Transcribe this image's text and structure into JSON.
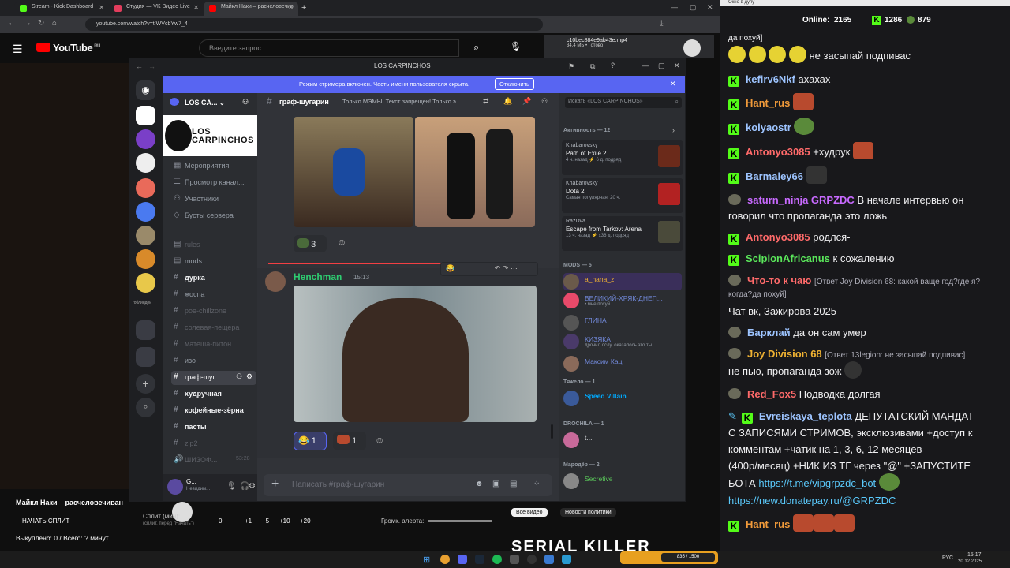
{
  "browser": {
    "tabs": [
      {
        "title": "Stream - Kick Dashboard",
        "color": "#53fc18"
      },
      {
        "title": "Студия — VK Видео Live",
        "color": "#e23d5d"
      },
      {
        "title": "Майкл Наки – расчеловечив",
        "color": "#ff0000"
      }
    ],
    "new_tab": "+",
    "url": "youtube.com/watch?v=tIWVcbYw7_4",
    "download": {
      "file": "c10bec884e9ab43e.mp4",
      "status": "34.4 МБ • Готово"
    }
  },
  "youtube": {
    "logo": "YouTube",
    "region": "RU",
    "search_placeholder": "Введите запрос",
    "bottom": {
      "video_title": "Майкл Наки – расчеловечиван",
      "split_button": "НАЧАТЬ СПЛИТ",
      "split_label": "Сплит (мин):",
      "split_hint": "(сплит. перед \"Начать\")",
      "split_values": [
        "0",
        "+1",
        "+5",
        "+10",
        "+20"
      ],
      "alert_label": "Громк. алерта:",
      "bought": "Выкуплено: 0 / Всего: ? минут",
      "tabs": [
        "Все видео",
        "Новости политики"
      ],
      "promo": "SERIAL KILLER"
    }
  },
  "discord": {
    "window_title": "LOS CARPINCHOS",
    "banner_text": "Режим стримера включен. Часть имени пользователя скрыта.",
    "banner_button": "Отключить",
    "server_name": "LOS CA...",
    "server_banner_text": "LOS CARPINCHOS",
    "guild_label": "гоблиндеи",
    "nav": [
      {
        "label": "Мероприятия",
        "icon": "calendar-icon"
      },
      {
        "label": "Просмотр канал...",
        "icon": "browse-icon"
      },
      {
        "label": "Участники",
        "icon": "members-icon"
      },
      {
        "label": "Бусты сервера",
        "icon": "boost-icon"
      }
    ],
    "channels": [
      {
        "name": "rules",
        "state": "dim"
      },
      {
        "name": "mods",
        "state": "normal"
      },
      {
        "name": "дурка",
        "state": "bold"
      },
      {
        "name": "жоспа",
        "state": "normal"
      },
      {
        "name": "poe-chillzone",
        "state": "dim"
      },
      {
        "name": "солевая-пещера",
        "state": "dim"
      },
      {
        "name": "матеша-питон",
        "state": "dim"
      },
      {
        "name": "изо",
        "state": "normal"
      },
      {
        "name": "граф-шуг...",
        "state": "selected"
      },
      {
        "name": "худручная",
        "state": "bold"
      },
      {
        "name": "кофейные-зёрна",
        "state": "bold"
      },
      {
        "name": "пасты",
        "state": "bold"
      },
      {
        "name": "zip2",
        "state": "dim"
      },
      {
        "name": "ШИЗОФ...",
        "state": "dim",
        "time": "53:28"
      }
    ],
    "user": {
      "name": "G...",
      "status": "Невидим..."
    },
    "chat_header": {
      "channel": "граф-шугарин",
      "topic": "Только МЭМЫ. Текст запрещен! Только э...",
      "search_placeholder": "Искать «LOS CARPINCHOS»"
    },
    "messages": [
      {
        "reactions": [
          {
            "emoji": "pepe",
            "count": "3"
          }
        ]
      },
      {
        "author": "Henchman",
        "time": "15:13",
        "reactions": [
          {
            "emoji": "😂",
            "count": "1"
          },
          {
            "emoji": "lips",
            "count": "1"
          }
        ]
      }
    ],
    "input_placeholder": "Написать #граф-шугарин",
    "activity": {
      "title": "Активность — 12",
      "items": [
        {
          "user": "Khabarovsky",
          "game": "Path of Exile 2",
          "meta": "4 ч. назад  ⚡ 6 д. подряд",
          "color": "#6b2a1a"
        },
        {
          "user": "Khabarovsky",
          "game": "Dota 2",
          "meta": "Самая популярная: 20 ч.",
          "color": "#b22222"
        },
        {
          "user": "RazDva",
          "game": "Escape from Tarkov: Arena",
          "meta": "13 ч. назад  ⚡ x36 д. подряд",
          "color": "#4a4a3a"
        }
      ]
    },
    "members_groups": [
      {
        "title": "MODS — 5",
        "members": [
          {
            "name": "a_nana_z",
            "status": "",
            "color": "#f0b232",
            "av": "#6a5a4a"
          },
          {
            "name": "ВЕЛИКИЙ-ХРЯК-ДНЕП...",
            "status": "• мне похуй",
            "color": "#7289da",
            "av": "#e84a6a"
          },
          {
            "name": "ГЛИНА",
            "status": "",
            "color": "#7289da",
            "av": "#555"
          },
          {
            "name": "КИЗЯКА",
            "status": "дрочил ослу, оказалось это ты",
            "color": "#7289da",
            "av": "#4a3a6a"
          },
          {
            "name": "Максим Кац",
            "status": "",
            "color": "#7289da",
            "av": "#8a6a5a"
          }
        ]
      },
      {
        "title": "Тяжело — 1",
        "members": [
          {
            "name": "Speed Villain",
            "status": "",
            "color": "#00a8fc",
            "av": "#3a5a9a"
          }
        ]
      },
      {
        "title": "DROCHILA — 1",
        "members": [
          {
            "name": "t...",
            "status": "",
            "color": "#dbdee1",
            "av": "#c86a9a"
          }
        ]
      },
      {
        "title": "Мародёр — 2",
        "members": [
          {
            "name": "Secretive",
            "status": "",
            "color": "#5ac85a",
            "av": "#888"
          }
        ]
      }
    ]
  },
  "twitch": {
    "window_label": "Окно в дупу",
    "online_label": "Online:",
    "online": "2165",
    "kick_count": "1286",
    "viewers": "879",
    "messages": [
      {
        "user": "",
        "text": "да похуй]",
        "color": "#efeff1",
        "kick": false
      },
      {
        "user": "",
        "text": "не засыпай подпивас",
        "color": "#efeff1",
        "kick": false,
        "emotes": "yyyy"
      },
      {
        "user": "kefirv6Nkf",
        "text": "ахахах",
        "color": "#9dc4ff",
        "kick": true
      },
      {
        "user": "Hant_rus",
        "text": "",
        "color": "#f09a3a",
        "kick": true,
        "emotes": "f"
      },
      {
        "user": "kolyaostr",
        "text": "",
        "color": "#9dc4ff",
        "kick": true,
        "emotes": "g"
      },
      {
        "user": "Antonyo3085",
        "text": "+худрук",
        "color": "#ff6a6a",
        "kick": true,
        "emotes": "f"
      },
      {
        "user": "Barmaley66",
        "text": "",
        "color": "#9dc4ff",
        "kick": true,
        "emotes": "d"
      },
      {
        "user": "saturn_ninja",
        "badge": "GRPZDC",
        "text": "В начале интервью он",
        "cont": "говорил что пропаганда это ложь",
        "color": "#c86aff",
        "kick": false
      },
      {
        "user": "Antonyo3085",
        "text": "родлся-",
        "color": "#ff6a6a",
        "kick": true
      },
      {
        "user": "ScipionAfricanus",
        "text": "к сожалению",
        "color": "#5ae65a",
        "kick": true
      },
      {
        "user": "Что-то к чаю",
        "reply": "[Ответ Joy Division 68: какой ваще год?где я?",
        "cont": "когда?да похуй]",
        "color": "#ff6a6a",
        "kick": false
      },
      {
        "user": "",
        "text": "Чат вк, Зажирова 2025",
        "color": "#efeff1",
        "kick": false
      },
      {
        "user": "Барклай",
        "text": "да он сам умер",
        "color": "#9dc4ff",
        "kick": false
      },
      {
        "user": "Joy Division 68",
        "reply": "[Ответ 13legion: не засыпай подпивас]",
        "cont": "не пью, пропаганда зож",
        "color": "#f0b232",
        "kick": false
      },
      {
        "user": "Red_Fox5",
        "text": "Подводка долгая",
        "color": "#ff6a6a",
        "kick": false
      },
      {
        "user": "Evreiskaya_teplota",
        "text": "ДЕПУТАТСКИЙ МАНДАТ",
        "color": "#9dc4ff",
        "kick": true
      },
      {
        "user": "",
        "text": "С ЗАПИСЯМИ СТРИМОВ, эксклюзивами +доступ к",
        "color": "#efeff1"
      },
      {
        "user": "",
        "text": "комментам +чатик       на 1, 3, 6, 12 месяцев",
        "color": "#efeff1"
      },
      {
        "user": "",
        "text": "(400р/месяц) +НИК ИЗ ТГ через \"@\" +ЗАПУСТИТЕ",
        "color": "#efeff1"
      },
      {
        "user": "",
        "text": "БОТА",
        "link": "https://t.me/vipgrpzdc_bot",
        "color": "#efeff1"
      },
      {
        "user": "",
        "text": "",
        "link": "https://new.donatepay.ru/@GRPZDC",
        "color": "#efeff1"
      },
      {
        "user": "Hant_rus",
        "text": "",
        "color": "#f09a3a",
        "kick": true,
        "emotes": "fff"
      }
    ]
  },
  "taskbar": {
    "lang": "РУС",
    "time": "15:17",
    "date": "20.12.2025",
    "promo": "835 / 1500"
  }
}
